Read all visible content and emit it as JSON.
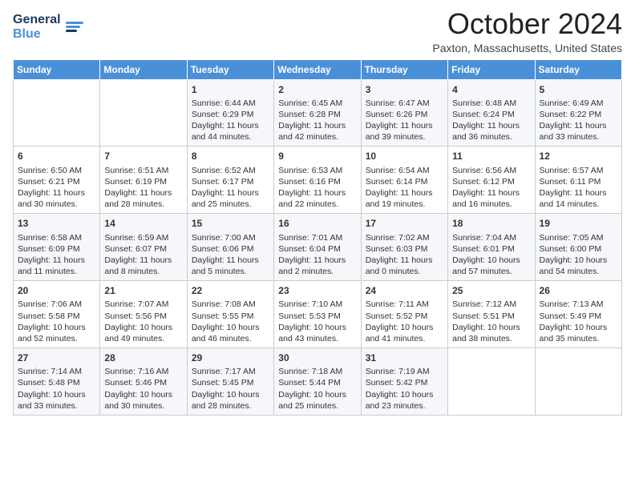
{
  "header": {
    "logo_line1": "General",
    "logo_line2": "Blue",
    "month_title": "October 2024",
    "location": "Paxton, Massachusetts, United States"
  },
  "days_of_week": [
    "Sunday",
    "Monday",
    "Tuesday",
    "Wednesday",
    "Thursday",
    "Friday",
    "Saturday"
  ],
  "weeks": [
    [
      {
        "day": "",
        "sunrise": "",
        "sunset": "",
        "daylight": ""
      },
      {
        "day": "",
        "sunrise": "",
        "sunset": "",
        "daylight": ""
      },
      {
        "day": "1",
        "sunrise": "Sunrise: 6:44 AM",
        "sunset": "Sunset: 6:29 PM",
        "daylight": "Daylight: 11 hours and 44 minutes."
      },
      {
        "day": "2",
        "sunrise": "Sunrise: 6:45 AM",
        "sunset": "Sunset: 6:28 PM",
        "daylight": "Daylight: 11 hours and 42 minutes."
      },
      {
        "day": "3",
        "sunrise": "Sunrise: 6:47 AM",
        "sunset": "Sunset: 6:26 PM",
        "daylight": "Daylight: 11 hours and 39 minutes."
      },
      {
        "day": "4",
        "sunrise": "Sunrise: 6:48 AM",
        "sunset": "Sunset: 6:24 PM",
        "daylight": "Daylight: 11 hours and 36 minutes."
      },
      {
        "day": "5",
        "sunrise": "Sunrise: 6:49 AM",
        "sunset": "Sunset: 6:22 PM",
        "daylight": "Daylight: 11 hours and 33 minutes."
      }
    ],
    [
      {
        "day": "6",
        "sunrise": "Sunrise: 6:50 AM",
        "sunset": "Sunset: 6:21 PM",
        "daylight": "Daylight: 11 hours and 30 minutes."
      },
      {
        "day": "7",
        "sunrise": "Sunrise: 6:51 AM",
        "sunset": "Sunset: 6:19 PM",
        "daylight": "Daylight: 11 hours and 28 minutes."
      },
      {
        "day": "8",
        "sunrise": "Sunrise: 6:52 AM",
        "sunset": "Sunset: 6:17 PM",
        "daylight": "Daylight: 11 hours and 25 minutes."
      },
      {
        "day": "9",
        "sunrise": "Sunrise: 6:53 AM",
        "sunset": "Sunset: 6:16 PM",
        "daylight": "Daylight: 11 hours and 22 minutes."
      },
      {
        "day": "10",
        "sunrise": "Sunrise: 6:54 AM",
        "sunset": "Sunset: 6:14 PM",
        "daylight": "Daylight: 11 hours and 19 minutes."
      },
      {
        "day": "11",
        "sunrise": "Sunrise: 6:56 AM",
        "sunset": "Sunset: 6:12 PM",
        "daylight": "Daylight: 11 hours and 16 minutes."
      },
      {
        "day": "12",
        "sunrise": "Sunrise: 6:57 AM",
        "sunset": "Sunset: 6:11 PM",
        "daylight": "Daylight: 11 hours and 14 minutes."
      }
    ],
    [
      {
        "day": "13",
        "sunrise": "Sunrise: 6:58 AM",
        "sunset": "Sunset: 6:09 PM",
        "daylight": "Daylight: 11 hours and 11 minutes."
      },
      {
        "day": "14",
        "sunrise": "Sunrise: 6:59 AM",
        "sunset": "Sunset: 6:07 PM",
        "daylight": "Daylight: 11 hours and 8 minutes."
      },
      {
        "day": "15",
        "sunrise": "Sunrise: 7:00 AM",
        "sunset": "Sunset: 6:06 PM",
        "daylight": "Daylight: 11 hours and 5 minutes."
      },
      {
        "day": "16",
        "sunrise": "Sunrise: 7:01 AM",
        "sunset": "Sunset: 6:04 PM",
        "daylight": "Daylight: 11 hours and 2 minutes."
      },
      {
        "day": "17",
        "sunrise": "Sunrise: 7:02 AM",
        "sunset": "Sunset: 6:03 PM",
        "daylight": "Daylight: 11 hours and 0 minutes."
      },
      {
        "day": "18",
        "sunrise": "Sunrise: 7:04 AM",
        "sunset": "Sunset: 6:01 PM",
        "daylight": "Daylight: 10 hours and 57 minutes."
      },
      {
        "day": "19",
        "sunrise": "Sunrise: 7:05 AM",
        "sunset": "Sunset: 6:00 PM",
        "daylight": "Daylight: 10 hours and 54 minutes."
      }
    ],
    [
      {
        "day": "20",
        "sunrise": "Sunrise: 7:06 AM",
        "sunset": "Sunset: 5:58 PM",
        "daylight": "Daylight: 10 hours and 52 minutes."
      },
      {
        "day": "21",
        "sunrise": "Sunrise: 7:07 AM",
        "sunset": "Sunset: 5:56 PM",
        "daylight": "Daylight: 10 hours and 49 minutes."
      },
      {
        "day": "22",
        "sunrise": "Sunrise: 7:08 AM",
        "sunset": "Sunset: 5:55 PM",
        "daylight": "Daylight: 10 hours and 46 minutes."
      },
      {
        "day": "23",
        "sunrise": "Sunrise: 7:10 AM",
        "sunset": "Sunset: 5:53 PM",
        "daylight": "Daylight: 10 hours and 43 minutes."
      },
      {
        "day": "24",
        "sunrise": "Sunrise: 7:11 AM",
        "sunset": "Sunset: 5:52 PM",
        "daylight": "Daylight: 10 hours and 41 minutes."
      },
      {
        "day": "25",
        "sunrise": "Sunrise: 7:12 AM",
        "sunset": "Sunset: 5:51 PM",
        "daylight": "Daylight: 10 hours and 38 minutes."
      },
      {
        "day": "26",
        "sunrise": "Sunrise: 7:13 AM",
        "sunset": "Sunset: 5:49 PM",
        "daylight": "Daylight: 10 hours and 35 minutes."
      }
    ],
    [
      {
        "day": "27",
        "sunrise": "Sunrise: 7:14 AM",
        "sunset": "Sunset: 5:48 PM",
        "daylight": "Daylight: 10 hours and 33 minutes."
      },
      {
        "day": "28",
        "sunrise": "Sunrise: 7:16 AM",
        "sunset": "Sunset: 5:46 PM",
        "daylight": "Daylight: 10 hours and 30 minutes."
      },
      {
        "day": "29",
        "sunrise": "Sunrise: 7:17 AM",
        "sunset": "Sunset: 5:45 PM",
        "daylight": "Daylight: 10 hours and 28 minutes."
      },
      {
        "day": "30",
        "sunrise": "Sunrise: 7:18 AM",
        "sunset": "Sunset: 5:44 PM",
        "daylight": "Daylight: 10 hours and 25 minutes."
      },
      {
        "day": "31",
        "sunrise": "Sunrise: 7:19 AM",
        "sunset": "Sunset: 5:42 PM",
        "daylight": "Daylight: 10 hours and 23 minutes."
      },
      {
        "day": "",
        "sunrise": "",
        "sunset": "",
        "daylight": ""
      },
      {
        "day": "",
        "sunrise": "",
        "sunset": "",
        "daylight": ""
      }
    ]
  ]
}
